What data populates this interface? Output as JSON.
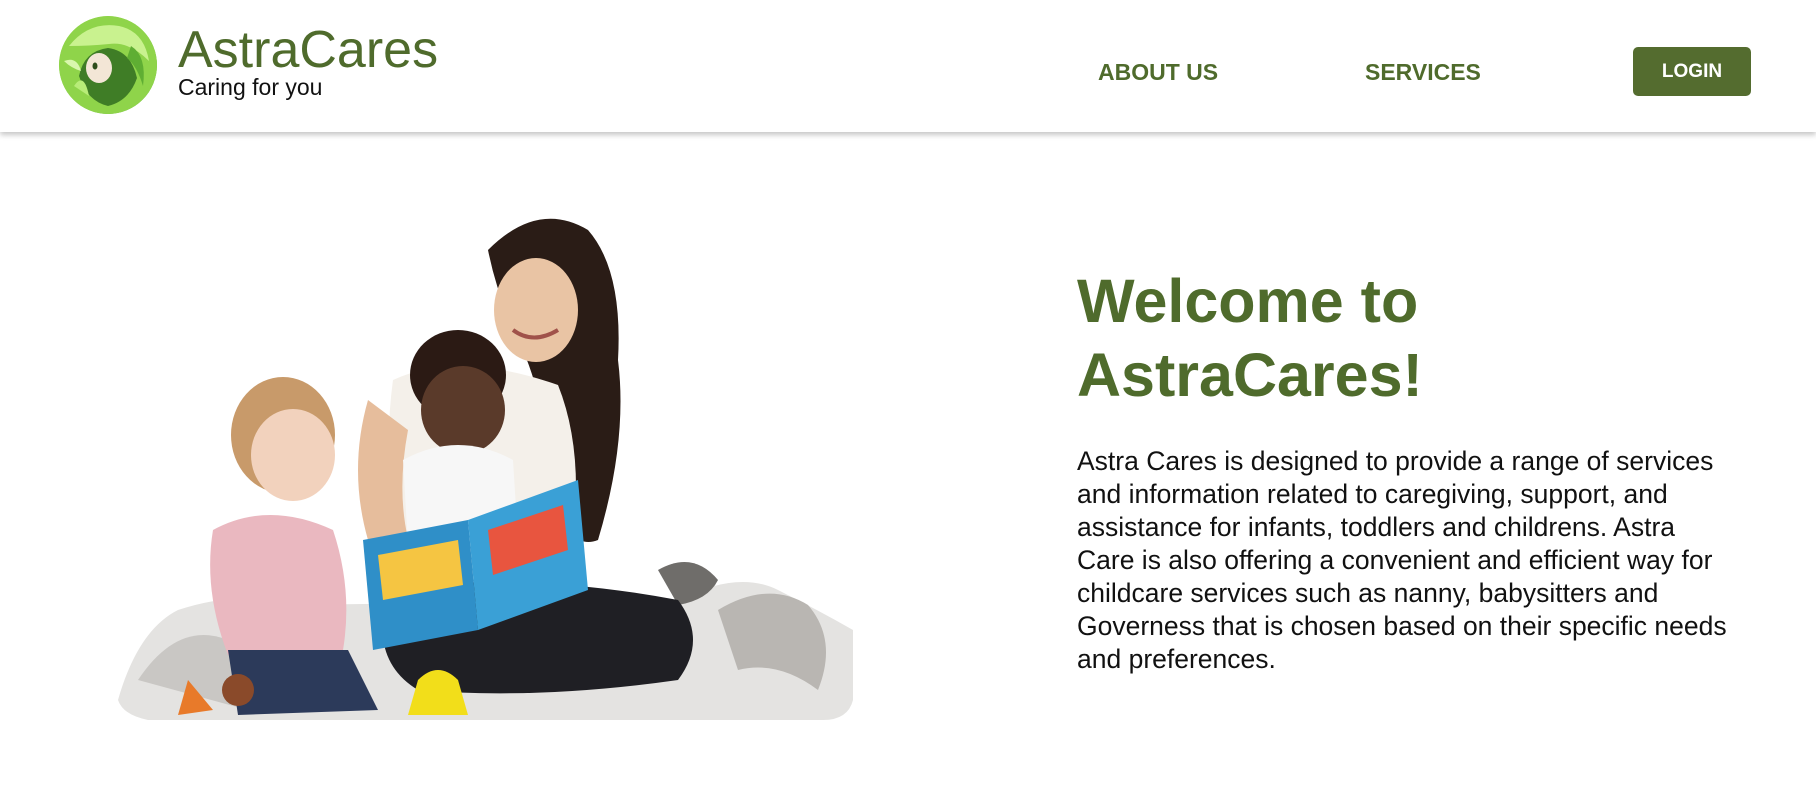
{
  "brand": {
    "name": "AstraCares",
    "tagline": "Caring for you"
  },
  "nav": {
    "about": "ABOUT US",
    "services": "SERVICES",
    "login": "LOGIN"
  },
  "hero": {
    "title_line1": "Welcome to",
    "title_line2": "AstraCares!",
    "description": "Astra Cares is designed to provide a range of services and information related to caregiving, support, and assistance for infants, toddlers and childrens. Astra Care is also offering a convenient and efficient way for childcare services such as nanny, babysitters and Governess that is chosen based on their specific needs and preferences."
  },
  "colors": {
    "brand_green": "#4f6b2c",
    "button_green": "#546c2f",
    "text_dark": "#111111",
    "background": "#ffffff"
  }
}
